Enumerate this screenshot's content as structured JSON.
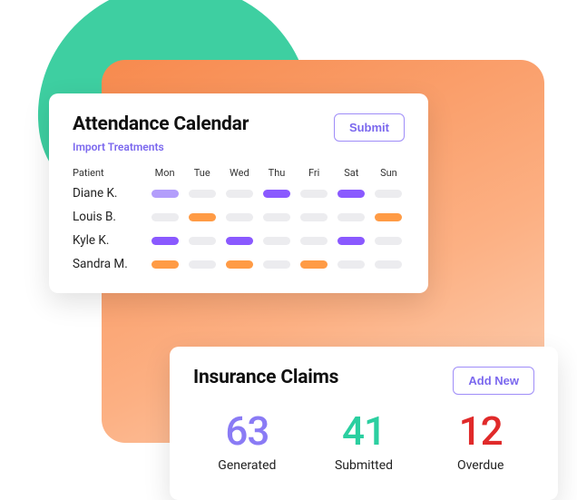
{
  "attendance": {
    "title": "Attendance Calendar",
    "submit_label": "Submit",
    "import_link": "Import Treatments",
    "columns": [
      "Patient",
      "Mon",
      "Tue",
      "Wed",
      "Thu",
      "Fri",
      "Sat",
      "Sun"
    ],
    "rows": [
      {
        "name": "Diane K.",
        "days": [
          "lav",
          "none",
          "none",
          "purple",
          "none",
          "purple",
          "none"
        ]
      },
      {
        "name": "Louis B.",
        "days": [
          "none",
          "orange",
          "none",
          "none",
          "none",
          "none",
          "orange"
        ]
      },
      {
        "name": "Kyle K.",
        "days": [
          "purple",
          "none",
          "purple",
          "none",
          "none",
          "purple",
          "none"
        ]
      },
      {
        "name": "Sandra M.",
        "days": [
          "orange",
          "none",
          "orange",
          "none",
          "orange",
          "none",
          "none"
        ]
      }
    ]
  },
  "claims": {
    "title": "Insurance Claims",
    "add_label": "Add New",
    "stats": [
      {
        "value": "63",
        "label": "Generated",
        "color": "#8a7bf5"
      },
      {
        "value": "41",
        "label": "Submitted",
        "color": "#2bcfa0"
      },
      {
        "value": "12",
        "label": "Overdue",
        "color": "#e02a2a"
      }
    ]
  }
}
